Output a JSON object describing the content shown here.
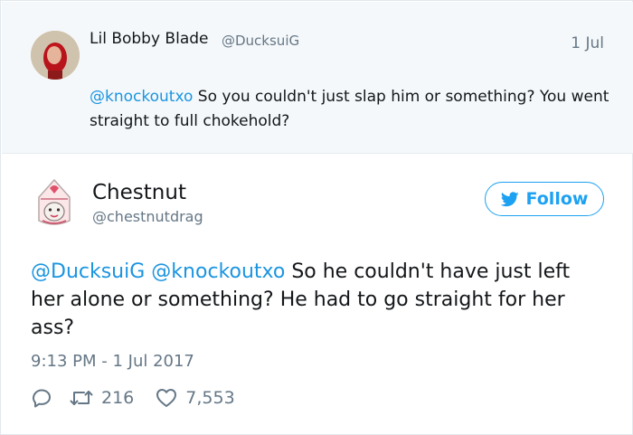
{
  "parent_tweet": {
    "author_name": "Lil Bobby Blade",
    "author_handle": "@DucksuiG",
    "date": "1 Jul",
    "mention": "@knockoutxo",
    "text": " So you couldn't just slap him or something? You went straight to full chokehold?",
    "avatar_icon": "red-haired-person-avatar"
  },
  "tweet": {
    "author_name": "Chestnut",
    "author_handle": "@chestnutdrag",
    "follow_label": "Follow",
    "mention_1": "@DucksuiG",
    "mention_2": "@knockoutxo",
    "text": " So he couldn't have just left her alone or something? He had to go straight for her ass?",
    "timestamp": "9:13 PM - 1 Jul 2017",
    "retweet_count": "216",
    "like_count": "7,553",
    "avatar_icon": "drag-queen-illustration-avatar"
  },
  "colors": {
    "link": "#1b95e0",
    "twitter_blue": "#1da1f2",
    "muted": "#657786",
    "parent_bg": "#f5f8fa"
  }
}
